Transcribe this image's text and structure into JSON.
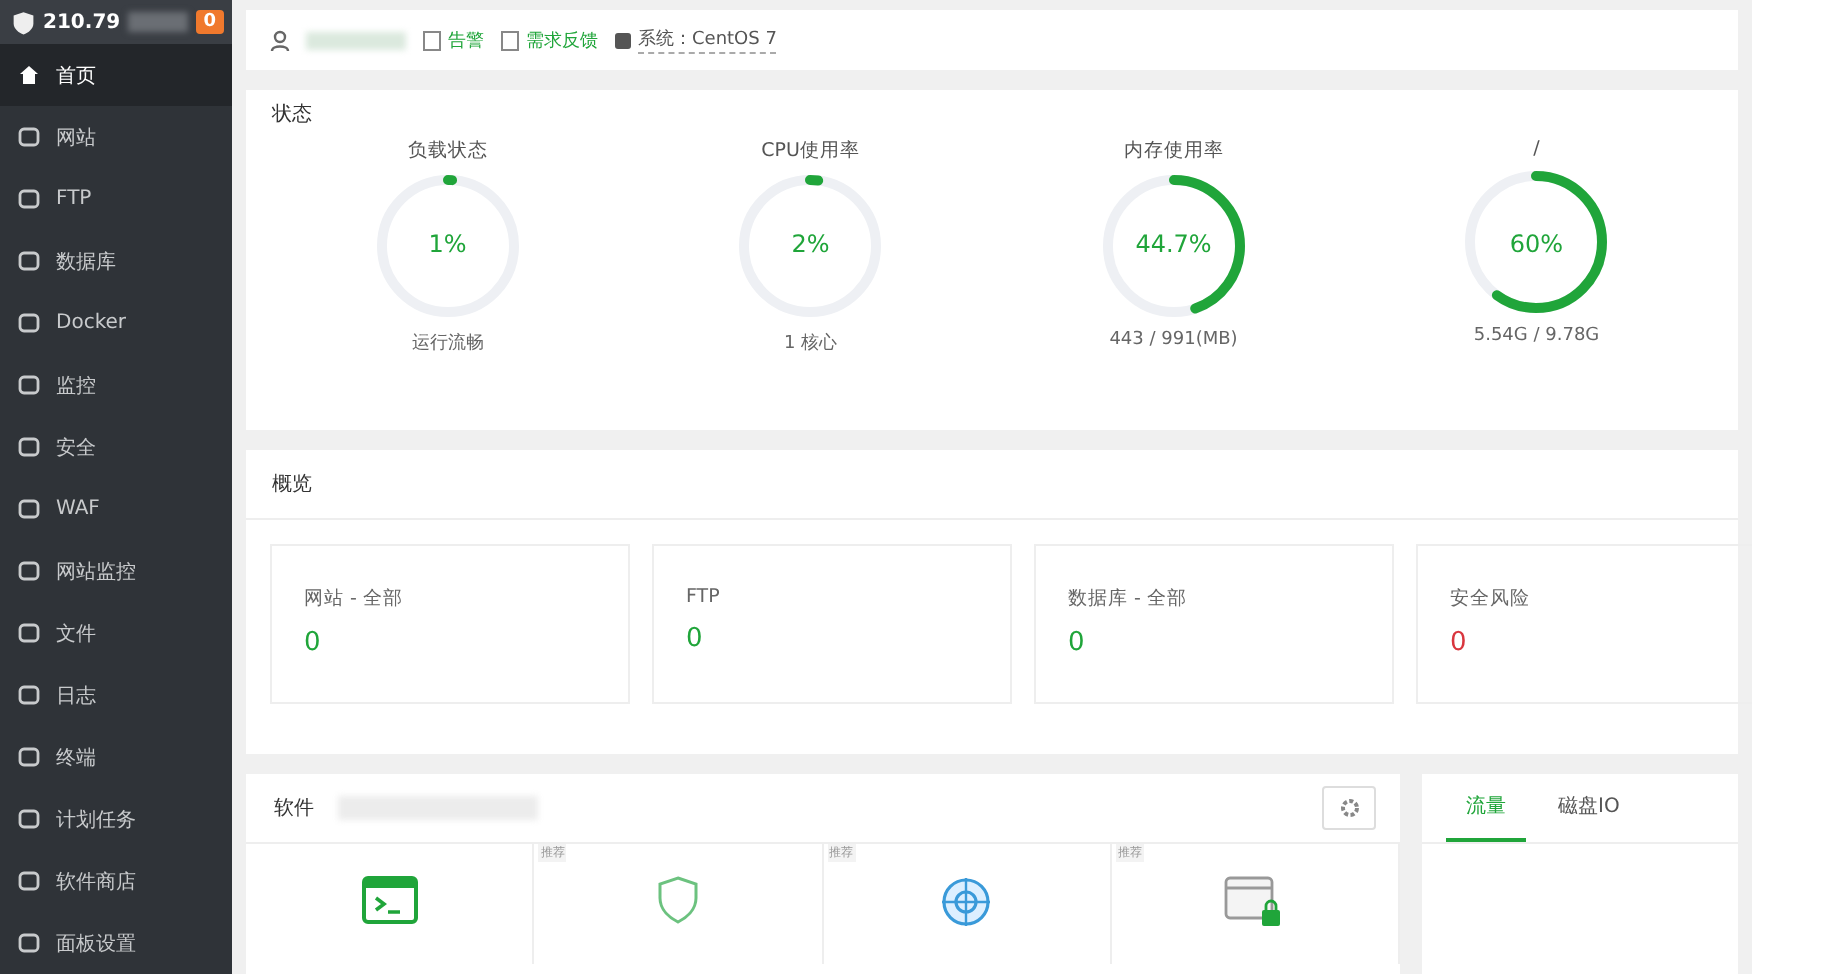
{
  "sidebar": {
    "server": "210.79",
    "badge": "0",
    "items": [
      {
        "label": "首页",
        "selected": true
      },
      {
        "label": "网站",
        "selected": false
      },
      {
        "label": "FTP",
        "selected": false
      },
      {
        "label": "数据库",
        "selected": false
      },
      {
        "label": "Docker",
        "selected": false
      },
      {
        "label": "监控",
        "selected": false
      },
      {
        "label": "安全",
        "selected": false
      },
      {
        "label": "WAF",
        "selected": false
      },
      {
        "label": "网站监控",
        "selected": false
      },
      {
        "label": "文件",
        "selected": false
      },
      {
        "label": "日志",
        "selected": false
      },
      {
        "label": "终端",
        "selected": false
      },
      {
        "label": "计划任务",
        "selected": false
      },
      {
        "label": "软件商店",
        "selected": false
      },
      {
        "label": "面板设置",
        "selected": false
      }
    ]
  },
  "topbar": {
    "links": [
      "告警",
      "需求反馈"
    ],
    "system": "系统：CentOS 7"
  },
  "status": {
    "title": "状态",
    "gauges": [
      {
        "label": "负载状态",
        "value": "1%",
        "level": 0.01,
        "detail": "运行流畅"
      },
      {
        "label": "CPU使用率",
        "value": "2%",
        "level": 0.02,
        "detail": "1 核心"
      },
      {
        "label": "内存使用率",
        "value": "44.7%",
        "level": 0.447,
        "detail": "443 / 991(MB)"
      },
      {
        "label": "/",
        "value": "60%",
        "level": 0.6,
        "detail": "5.54G / 9.78G"
      }
    ]
  },
  "overview": {
    "title": "概览",
    "items": [
      {
        "label": "网站 - 全部",
        "count": "0",
        "color": "#20a53a"
      },
      {
        "label": "FTP",
        "count": "0",
        "color": "#20a53a"
      },
      {
        "label": "数据库 - 全部",
        "count": "0",
        "color": "#20a53a"
      },
      {
        "label": "安全风险",
        "count": "0",
        "color": "#d9363e"
      }
    ]
  },
  "software": {
    "title": "软件",
    "tiles": [
      {
        "kind": "terminal"
      },
      {
        "kind": "shield",
        "tag": "推荐"
      },
      {
        "kind": "target",
        "tag": "推荐"
      },
      {
        "kind": "window-lock",
        "tag": "推荐"
      }
    ]
  },
  "traffic": {
    "tabs": [
      {
        "label": "流量",
        "selected": true
      },
      {
        "label": "磁盘IO",
        "selected": false
      }
    ]
  }
}
